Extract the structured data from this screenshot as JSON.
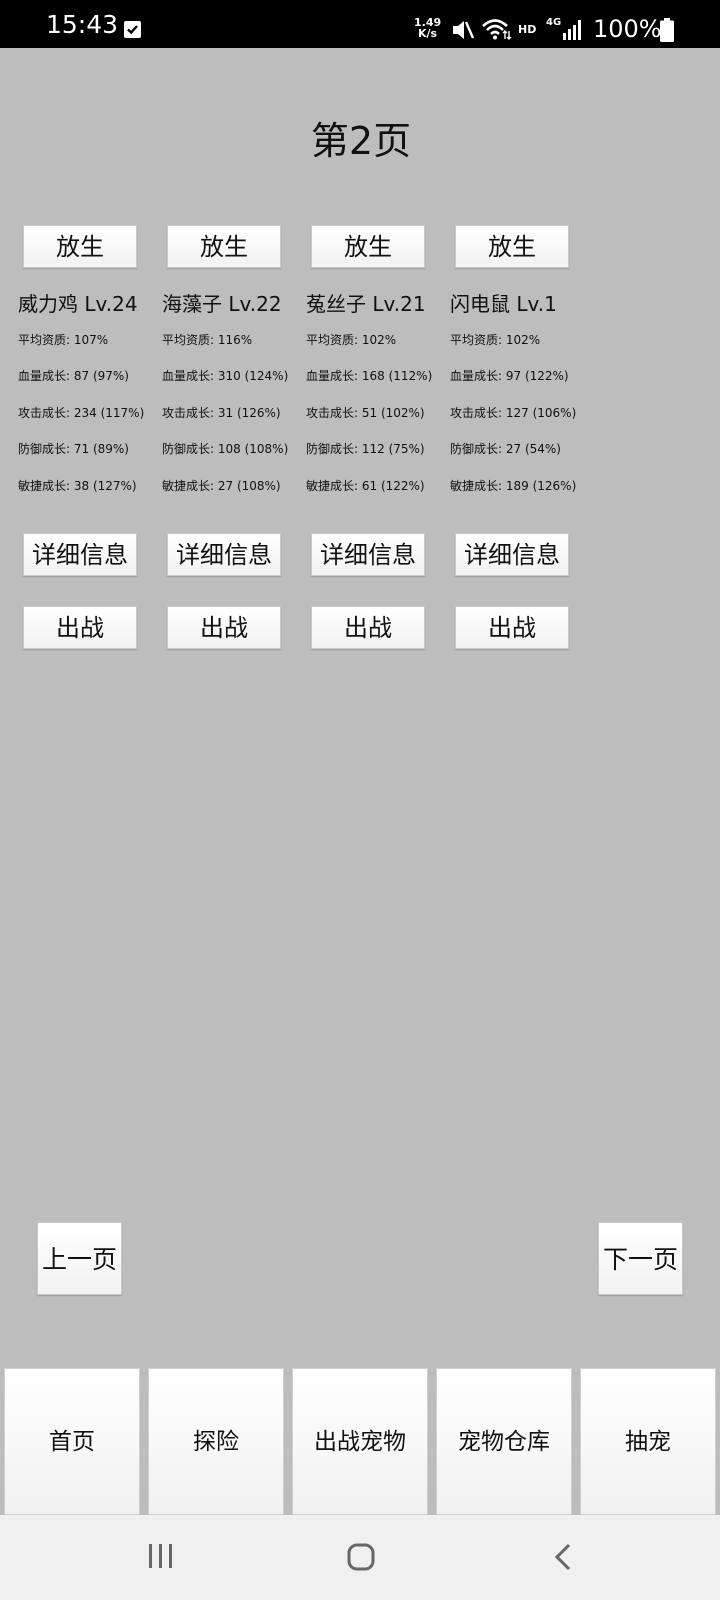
{
  "status_bar": {
    "time": "15:43",
    "net_speed_value": "1.49",
    "net_speed_unit": "K/s",
    "hd": "HD",
    "lte": "4G",
    "battery": "100%"
  },
  "page_title": "第2页",
  "pets": [
    {
      "release_label": "放生",
      "name": "威力鸡 Lv.24",
      "stats": [
        "平均资质:  107%",
        "血量成长: 87 (97%)",
        "攻击成长: 234 (117%)",
        "防御成长: 71 (89%)",
        "敏捷成长: 38 (127%)"
      ],
      "detail_label": "详细信息",
      "battle_label": "出战"
    },
    {
      "release_label": "放生",
      "name": "海藻子 Lv.22",
      "stats": [
        "平均资质:  116%",
        "血量成长: 310 (124%)",
        "攻击成长: 31 (126%)",
        "防御成长: 108 (108%)",
        "敏捷成长: 27 (108%)"
      ],
      "detail_label": "详细信息",
      "battle_label": "出战"
    },
    {
      "release_label": "放生",
      "name": "菟丝子 Lv.21",
      "stats": [
        "平均资质:  102%",
        "血量成长: 168 (112%)",
        "攻击成长: 51 (102%)",
        "防御成长: 112 (75%)",
        "敏捷成长: 61 (122%)"
      ],
      "detail_label": "详细信息",
      "battle_label": "出战"
    },
    {
      "release_label": "放生",
      "name": "闪电鼠 Lv.1",
      "stats": [
        "平均资质:  102%",
        "血量成长: 97 (122%)",
        "攻击成长: 127 (106%)",
        "防御成长: 27 (54%)",
        "敏捷成长: 189 (126%)"
      ],
      "detail_label": "详细信息",
      "battle_label": "出战"
    }
  ],
  "pagination": {
    "prev_label": "上一页",
    "next_label": "下一页"
  },
  "tabs": [
    {
      "label": "首页"
    },
    {
      "label": "探险"
    },
    {
      "label": "出战宠物"
    },
    {
      "label": "宠物仓库"
    },
    {
      "label": "抽宠"
    }
  ],
  "icons": {
    "status": [
      "check-icon",
      "mute-icon",
      "wifi-icon",
      "signal-icon",
      "battery-icon"
    ],
    "nav": [
      "recent-apps-icon",
      "home-icon",
      "back-icon"
    ]
  }
}
